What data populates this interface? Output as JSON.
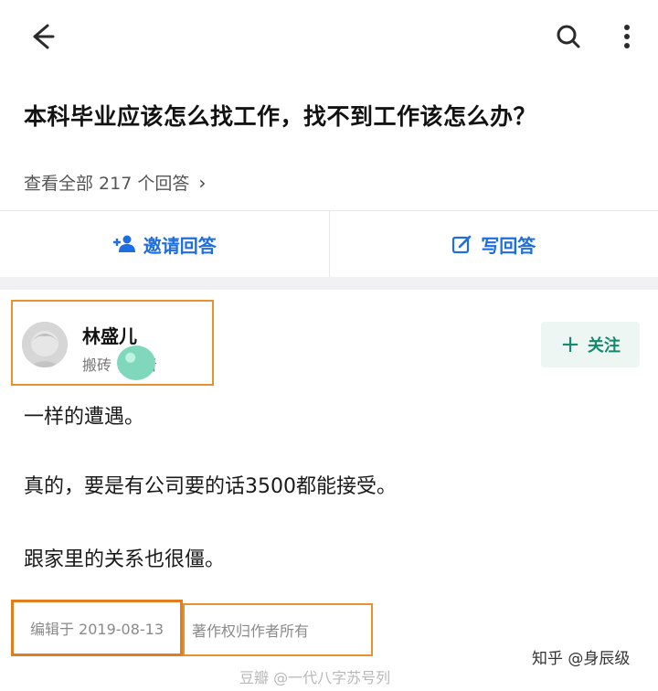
{
  "icons": {
    "back": "arrow-left",
    "search": "magnifier",
    "more": "three-dots-vertical",
    "invite": "person-plus",
    "write": "pencil-square"
  },
  "question": {
    "title": "本科毕业应该怎么找工作，找不到工作该怎么办？",
    "view_all": "查看全部 217 个回答",
    "view_all_chevron": "›"
  },
  "actions": {
    "invite_label": "邀请回答",
    "write_label": "写回答"
  },
  "answer": {
    "author_name": "林盛儿",
    "author_bio": "搬砖",
    "author_bio_end": "者",
    "follow_label": "关注",
    "follow_plus": "+",
    "paragraphs": [
      "一样的遭遇。",
      "真的，要是有公司要的话3500都能接受。",
      "跟家里的关系也很僵。"
    ],
    "edited": "编辑于 2019-08-13",
    "copyright": "著作权归作者所有"
  },
  "watermarks": {
    "bottom": "豆瓣 @一代八字苏号列",
    "right": "知乎 @身辰级"
  },
  "colors": {
    "accent_blue": "#1d6ee0",
    "follow_green": "#138a6c",
    "highlight_orange": "#e59330"
  }
}
